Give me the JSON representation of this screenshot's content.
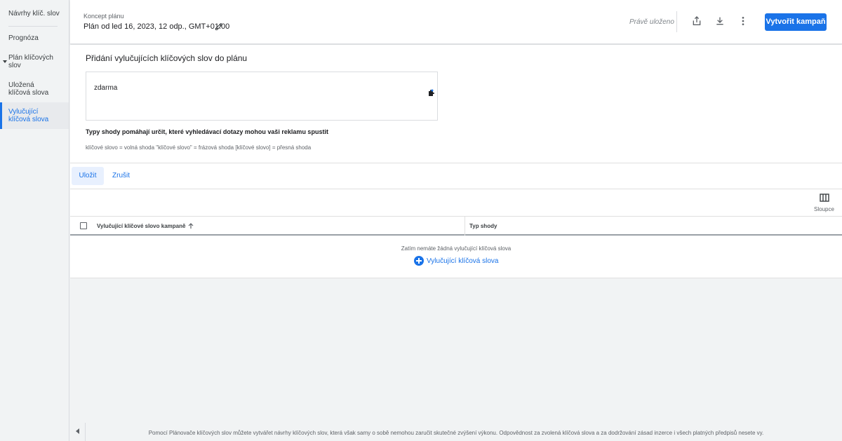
{
  "sidebar": {
    "items": [
      {
        "label": "Návrhy klíč. slov"
      },
      {
        "label": "Prognóza"
      },
      {
        "label": "Plán klíčových slov"
      },
      {
        "label": "Uložená klíčová slova"
      },
      {
        "label": "Vylučující klíčová slova"
      }
    ]
  },
  "header": {
    "subtitle": "Koncept plánu",
    "title": "Plán od led 16, 2023, 12 odp., GMT+01:00",
    "saved_status": "Právě uloženo",
    "create_button": "Vytvořit kampaň"
  },
  "main": {
    "title": "Přidání vylučujících klíčových slov do plánu",
    "keyword_value": "zdarma",
    "help_bold": "Typy shody pomáhají určit, které vyhledávací dotazy mohou vaši reklamu spustit",
    "help_small": "klíčové slovo = volná shoda  \"klíčové slovo\" = frázová shoda  [klíčové slovo] = přesná shoda",
    "save_button": "Uložit",
    "cancel_button": "Zrušit",
    "columns_label": "Sloupce",
    "table": {
      "headers": [
        "Vylučující klíčové slovo kampaně",
        "Typ shody"
      ],
      "empty_message": "Zatím nemáte žádná vylučující klíčová slova",
      "add_link": "Vylučující klíčová slova"
    }
  },
  "footer": {
    "text": "Pomocí Plánovače klíčových slov můžete vytvářet návrhy klíčových slov, která však samy o sobě nemohou zaručit skutečné zvýšení výkonu. Odpovědnost za zvolená klíčová slova a za dodržování zásad inzerce i všech platných předpisů nesete vy."
  },
  "colors": {
    "accent": "#1a73e8",
    "sidebar_bg": "#f1f3f4"
  }
}
